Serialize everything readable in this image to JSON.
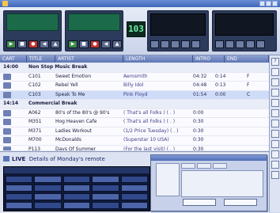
{
  "window": {
    "title": ""
  },
  "counter": {
    "value": "103"
  },
  "columns": [
    "CART",
    "TITLE",
    "ARTIST",
    "LENGTH",
    "INTRO",
    "END"
  ],
  "playlist": [
    {
      "kind": "group",
      "id": "14:00",
      "title": "Non Stop Music Break"
    },
    {
      "kind": "item",
      "id": "C101",
      "title": "Sweet Emotion",
      "artist": "Aerosmith",
      "length": "04:32",
      "intro": "0:14",
      "end": "F"
    },
    {
      "kind": "item",
      "id": "C102",
      "title": "Rebel Yell",
      "artist": "Billy Idol",
      "length": "04:48",
      "intro": "0:13",
      "end": "F"
    },
    {
      "kind": "item",
      "id": "C103",
      "title": "Speak To Me",
      "artist": "Pink Floyd",
      "length": "01:54",
      "intro": "0:00",
      "end": "C",
      "selected": true
    },
    {
      "kind": "group",
      "id": "14:14",
      "title": "Commercial Break"
    },
    {
      "kind": "item",
      "id": "A062",
      "title": "80's of the 80's @ 90's",
      "artist": "( That's all Folks ) ( . )",
      "length": "0:00",
      "intro": "",
      "end": ""
    },
    {
      "kind": "item",
      "id": "M351",
      "title": "Hog Heaven Cafe",
      "artist": "( That's all Folks ) ( . )",
      "length": "0:30",
      "intro": "",
      "end": ""
    },
    {
      "kind": "item",
      "id": "M371",
      "title": "Ladies Workout",
      "artist": "(1/2 Price Tuesday) ( . )",
      "length": "0:30",
      "intro": "",
      "end": ""
    },
    {
      "kind": "item",
      "id": "M700",
      "title": "McDonalds",
      "artist": "(Superstar 10 USA)",
      "length": "0:30",
      "intro": "",
      "end": ""
    },
    {
      "kind": "item",
      "id": "P113",
      "title": "Days Of Summer",
      "artist": "(For the last visit) ( . )",
      "length": "0:30",
      "intro": "",
      "end": ""
    }
  ],
  "bottom": {
    "label": "LIVE",
    "title": "Details of Monday's remote"
  },
  "icons": [
    "play-icon",
    "stop-icon",
    "record-icon",
    "cue-icon",
    "eject-icon",
    "tool-icon"
  ],
  "colors": {
    "accent": "#3f66b8",
    "lcd": "#1b6b4a",
    "record": "#c0342f"
  }
}
